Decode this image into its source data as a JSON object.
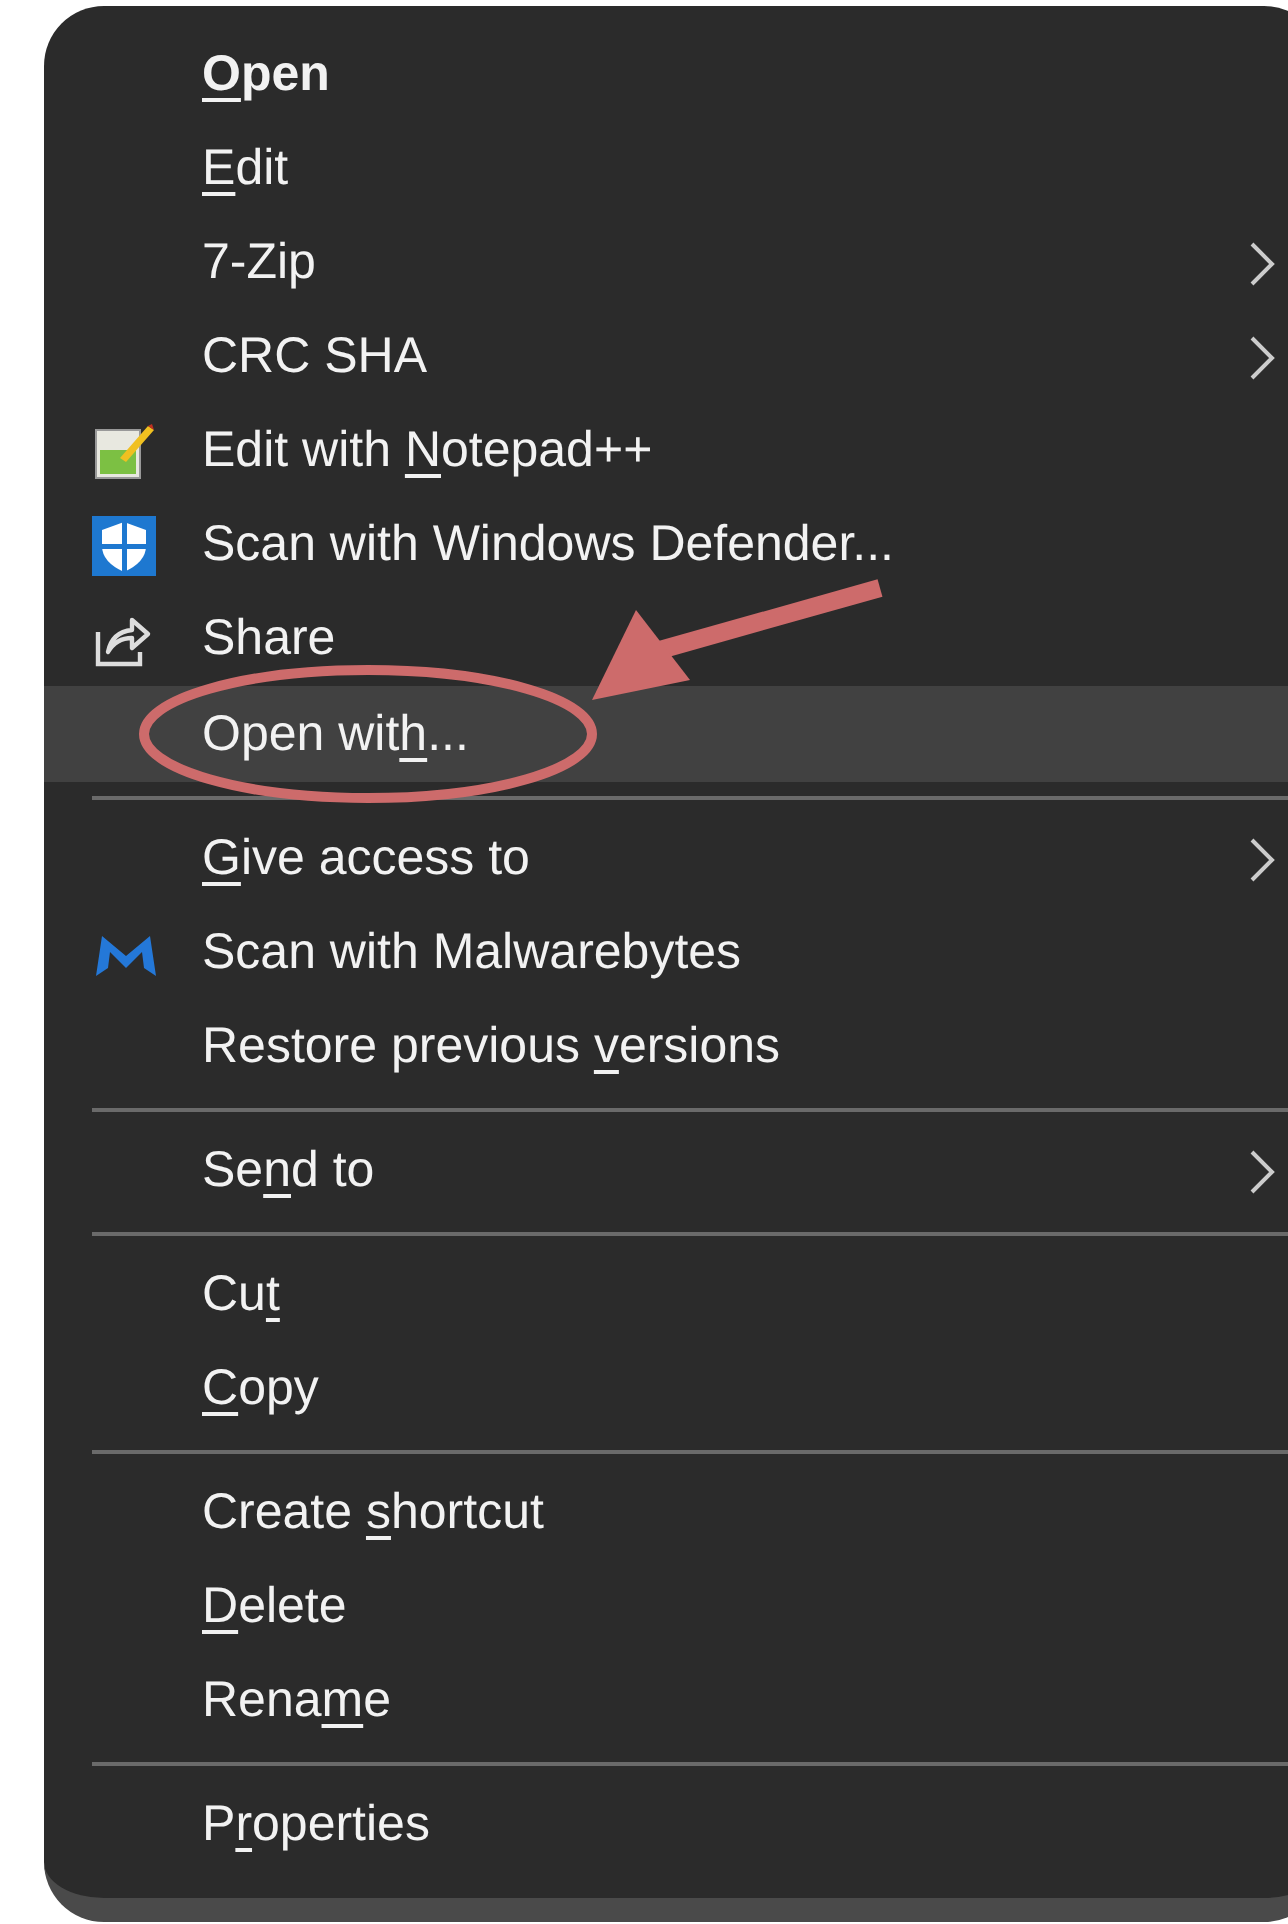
{
  "context_menu": {
    "groups": [
      {
        "items": [
          {
            "label": [
              {
                "text": "O",
                "underlined": true
              },
              {
                "text": "pen",
                "underlined": false
              }
            ],
            "bold": true,
            "selected": false,
            "submenu": false
          },
          {
            "label": [
              {
                "text": "E",
                "underlined": true
              },
              {
                "text": "dit",
                "underlined": false
              }
            ],
            "bold": false,
            "selected": false,
            "submenu": false
          },
          {
            "label": [
              {
                "text": "7-Zip",
                "underlined": false
              }
            ],
            "bold": false,
            "selected": false,
            "submenu": true
          },
          {
            "label": [
              {
                "text": "CRC SHA",
                "underlined": false
              }
            ],
            "bold": false,
            "selected": false,
            "submenu": true
          },
          {
            "label": [
              {
                "text": "Edit with ",
                "underlined": false
              },
              {
                "text": "N",
                "underlined": true
              },
              {
                "text": "otepad++",
                "underlined": false
              }
            ],
            "bold": false,
            "selected": false,
            "submenu": false,
            "kind": "notepad"
          },
          {
            "label": [
              {
                "text": "Scan with Windows Defender...",
                "underlined": false
              }
            ],
            "bold": false,
            "selected": false,
            "submenu": false,
            "kind": "shield"
          },
          {
            "label": [
              {
                "text": "Share",
                "underlined": false
              }
            ],
            "bold": false,
            "selected": false,
            "submenu": false,
            "kind": "share"
          },
          {
            "label": [
              {
                "text": "Open wit",
                "underlined": false
              },
              {
                "text": "h",
                "underlined": true
              },
              {
                "text": "...",
                "underlined": false
              }
            ],
            "bold": false,
            "selected": true,
            "submenu": false
          }
        ]
      },
      {
        "items": [
          {
            "label": [
              {
                "text": "G",
                "underlined": true
              },
              {
                "text": "ive access to",
                "underlined": false
              }
            ],
            "bold": false,
            "selected": false,
            "submenu": true
          },
          {
            "label": [
              {
                "text": "Scan with Malwarebytes",
                "underlined": false
              }
            ],
            "bold": false,
            "selected": false,
            "submenu": false,
            "kind": "mlogo"
          },
          {
            "label": [
              {
                "text": "Restore previous ",
                "underlined": false
              },
              {
                "text": "v",
                "underlined": true
              },
              {
                "text": "ersions",
                "underlined": false
              }
            ],
            "bold": false,
            "selected": false,
            "submenu": false
          }
        ]
      },
      {
        "items": [
          {
            "label": [
              {
                "text": "Se",
                "underlined": false
              },
              {
                "text": "n",
                "underlined": true
              },
              {
                "text": "d to",
                "underlined": false
              }
            ],
            "bold": false,
            "selected": false,
            "submenu": true
          }
        ]
      },
      {
        "items": [
          {
            "label": [
              {
                "text": "Cu",
                "underlined": false
              },
              {
                "text": "t",
                "underlined": true
              }
            ],
            "bold": false,
            "selected": false,
            "submenu": false
          },
          {
            "label": [
              {
                "text": "C",
                "underlined": true
              },
              {
                "text": "opy",
                "underlined": false
              }
            ],
            "bold": false,
            "selected": false,
            "submenu": false
          }
        ]
      },
      {
        "items": [
          {
            "label": [
              {
                "text": "Create ",
                "underlined": false
              },
              {
                "text": "s",
                "underlined": true
              },
              {
                "text": "hortcut",
                "underlined": false
              }
            ],
            "bold": false,
            "selected": false,
            "submenu": false
          },
          {
            "label": [
              {
                "text": "D",
                "underlined": true
              },
              {
                "text": "elete",
                "underlined": false
              }
            ],
            "bold": false,
            "selected": false,
            "submenu": false
          },
          {
            "label": [
              {
                "text": "Rena",
                "underlined": false
              },
              {
                "text": "m",
                "underlined": true
              },
              {
                "text": "e",
                "underlined": false
              }
            ],
            "bold": false,
            "selected": false,
            "submenu": false
          }
        ]
      },
      {
        "items": [
          {
            "label": [
              {
                "text": "P",
                "underlined": false
              },
              {
                "text": "r",
                "underlined": true
              },
              {
                "text": "operties",
                "underlined": false
              }
            ],
            "bold": false,
            "selected": false,
            "submenu": false
          }
        ]
      }
    ]
  }
}
